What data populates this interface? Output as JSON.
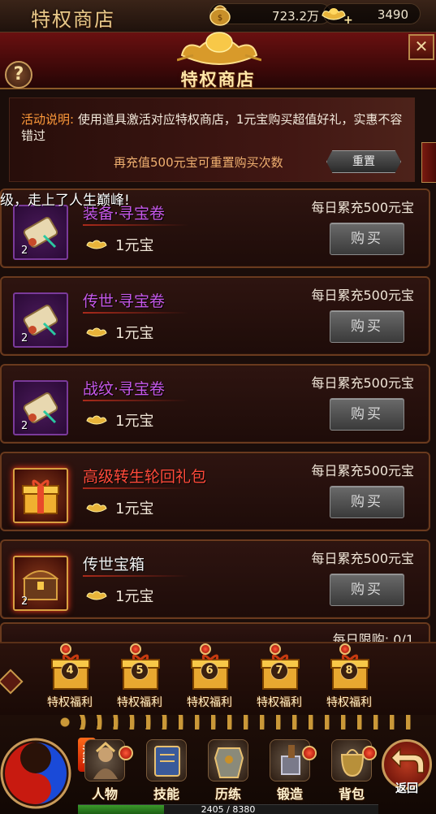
{
  "header": {
    "shop_title": "特权商店",
    "banner_title": "特权商店",
    "gold_amount": "723.2万",
    "ingot_amount": "3490",
    "help_symbol": "?",
    "close_symbol": "✕"
  },
  "activity": {
    "label": "活动说明:",
    "description": "使用道具激活对应特权商店，1元宝购买超值好礼，实惠不容错过",
    "recharge_hint": "再充值500元宝可重置购买次数",
    "reset_label": "重置"
  },
  "marquee": "级，走上了人生巅峰!",
  "items": [
    {
      "name": "装备·寻宝卷",
      "qty": "2",
      "price": "1元宝",
      "limit": "每日累充500元宝",
      "buy_label": "购买",
      "icon": "scroll-icon",
      "name_color": "#c658e8"
    },
    {
      "name": "传世·寻宝卷",
      "qty": "2",
      "price": "1元宝",
      "limit": "每日累充500元宝",
      "buy_label": "购买",
      "icon": "scroll-icon",
      "name_color": "#c658e8"
    },
    {
      "name": "战纹·寻宝卷",
      "qty": "2",
      "price": "1元宝",
      "limit": "每日累充500元宝",
      "buy_label": "购买",
      "icon": "scroll-icon",
      "name_color": "#c658e8"
    },
    {
      "name": "高级转生轮回礼包",
      "qty": "",
      "price": "1元宝",
      "limit": "每日累充500元宝",
      "buy_label": "购买",
      "icon": "gift-box-icon",
      "name_color": "#ff4a3a"
    },
    {
      "name": "传世宝箱",
      "qty": "2",
      "price": "1元宝",
      "limit": "每日累充500元宝",
      "buy_label": "购买",
      "icon": "treasure-chest-icon",
      "name_color": "#f0f0f0"
    }
  ],
  "partial_item_limit": "每日限购: 0/1",
  "welfare": [
    {
      "num": "4",
      "label": "特权福利"
    },
    {
      "num": "5",
      "label": "特权福利"
    },
    {
      "num": "6",
      "label": "特权福利"
    },
    {
      "num": "7",
      "label": "特权福利"
    },
    {
      "num": "8",
      "label": "特权福利"
    }
  ],
  "nav": {
    "activity_tag": "活动",
    "items": [
      {
        "label": "人物",
        "icon": "warrior-icon"
      },
      {
        "label": "技能",
        "icon": "skill-book-icon"
      },
      {
        "label": "历练",
        "icon": "armor-icon"
      },
      {
        "label": "锻造",
        "icon": "anvil-icon"
      },
      {
        "label": "背包",
        "icon": "bag-icon"
      }
    ],
    "return_label": "返回"
  },
  "exp": {
    "text": "2405 / 8380",
    "current": 2405,
    "max": 8380
  },
  "colors": {
    "accent": "#ff9a3a",
    "purple_name": "#c658e8",
    "red_name": "#ff4a3a"
  }
}
